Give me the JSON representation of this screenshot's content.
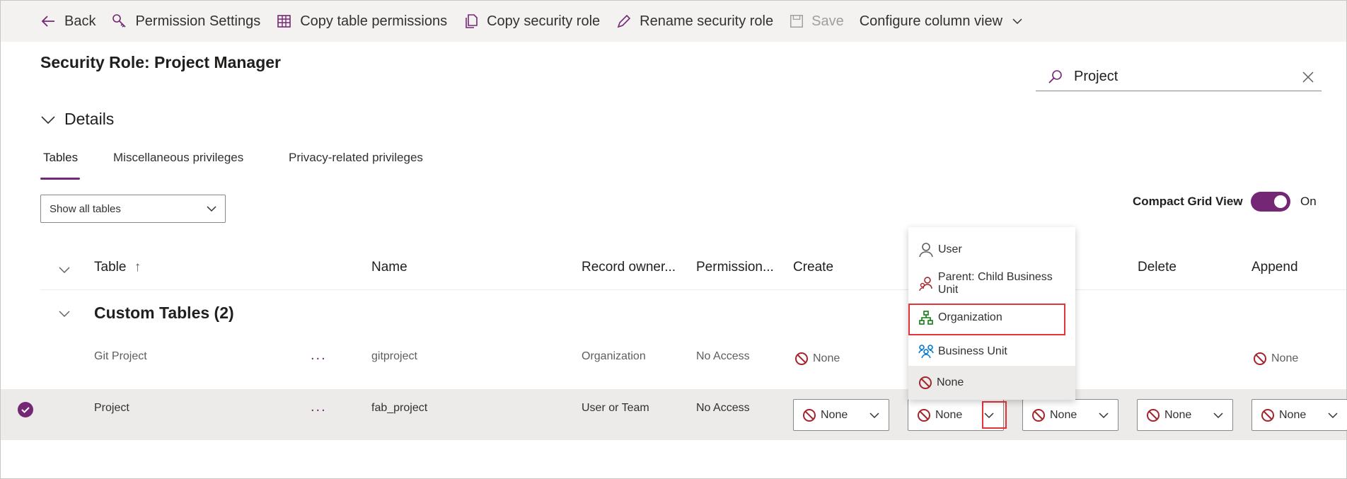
{
  "toolbar": {
    "back": "Back",
    "permission_settings": "Permission Settings",
    "copy_table_permissions": "Copy table permissions",
    "copy_security_role": "Copy security role",
    "rename_security_role": "Rename security role",
    "save": "Save",
    "configure_column_view": "Configure column view"
  },
  "page": {
    "title": "Security Role: Project Manager"
  },
  "search": {
    "value": "Project"
  },
  "details": {
    "label": "Details"
  },
  "tabs": [
    "Tables",
    "Miscellaneous privileges",
    "Privacy-related privileges"
  ],
  "filter": {
    "selected": "Show all tables"
  },
  "compact_grid": {
    "label": "Compact Grid View",
    "state": "On"
  },
  "columns": {
    "table": "Table",
    "name": "Name",
    "record_owner": "Record owner...",
    "permission": "Permission...",
    "create": "Create",
    "delete": "Delete",
    "append": "Append"
  },
  "group": {
    "title": "Custom Tables (2)"
  },
  "rows": [
    {
      "table": "Git Project",
      "more": "...",
      "name": "gitproject",
      "owner": "Organization",
      "permission": "No Access",
      "create": "None",
      "append": "None"
    },
    {
      "table": "Project",
      "more": "...",
      "name": "fab_project",
      "owner": "User or Team",
      "permission": "No Access",
      "create": "None",
      "read": "None",
      "write": "None",
      "delete": "None",
      "append": "None"
    }
  ],
  "dropdown": {
    "options": [
      "User",
      "Parent: Child Business Unit",
      "Organization",
      "Business Unit",
      "None"
    ],
    "highlighted": "Organization",
    "current": "None"
  },
  "colors": {
    "accent": "#742774",
    "highlight": "#e3343a",
    "none_icon": "#a4262c"
  }
}
